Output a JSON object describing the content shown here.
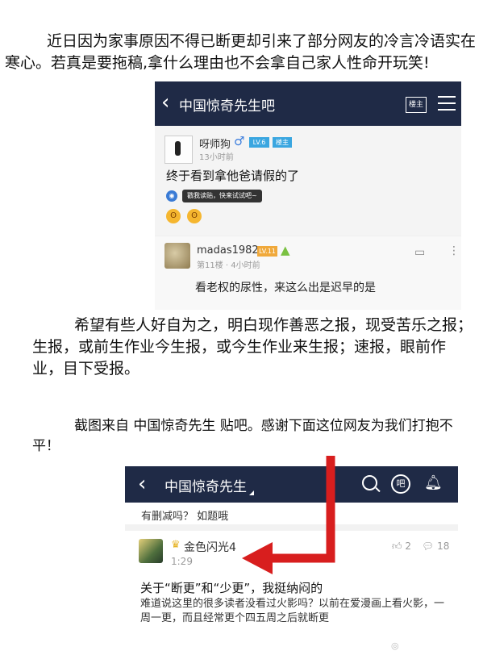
{
  "text": {
    "para1": "近日因为家事原因不得已断更却引来了部分网友的冷言冷语实在寒心。若真是要拖稿,拿什么理由也不会拿自己家人性命开玩笑!",
    "para2": "希望有些人好自为之，明白现作善恶之报，现受苦乐之报；生报，或前生作业今生报，或今生作业来生报；速报，眼前作业，目下受报。",
    "para3": "截图来自 中国惊奇先生 贴吧。感谢下面这位网友为我们打抱不平！"
  },
  "screenshot1": {
    "header": {
      "back_icon": "chevron-left",
      "title": "中国惊奇先生吧",
      "owner_button": "楼主",
      "menu_icon": "hamburger"
    },
    "post": {
      "username": "呀师狗",
      "gender_icon": "♂",
      "level_badge": "LV.6",
      "owner_badge": "楼主",
      "time": "13小时前",
      "content": "终于看到拿他爸请假的了",
      "voice_tip": "戳我读贴，快来试试吧~",
      "emojis": [
        "😲",
        "😲"
      ]
    },
    "reply": {
      "username": "madas1982",
      "level_badge": "LV.11",
      "floor_time": "第11楼 · 4小时前",
      "content": "看老权的尿性，来这么出是迟早的是"
    }
  },
  "screenshot2": {
    "header": {
      "back_icon": "chevron-left",
      "title": "中国惊奇先生",
      "ba_icon": "吧"
    },
    "prev_comment": "有删减吗？ 如题哦",
    "card": {
      "username": "金色闪光4",
      "time": "1:29",
      "likes": "2",
      "comments": "18",
      "title": "关于“断更”和“少更”，我挺纳闷的",
      "body": "难道说这里的很多读者没看过火影吗？以前在爱漫画上看火影，一周一更，而且经常更个四五周之后就断更"
    }
  },
  "colors": {
    "header_bg": "#1f2a46",
    "arrow": "#d81e1e",
    "badge_blue": "#3aa6e0",
    "badge_orange": "#f0a93b"
  }
}
